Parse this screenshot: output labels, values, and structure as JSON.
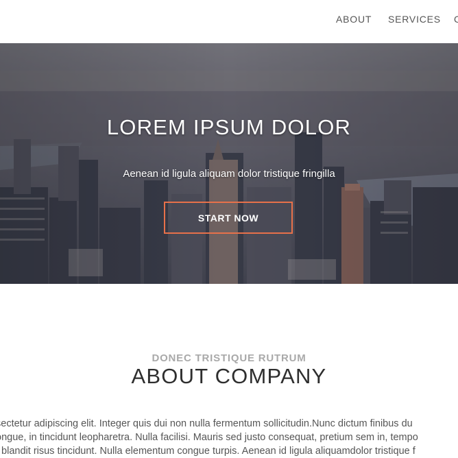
{
  "nav": {
    "items": [
      {
        "label": "ABOUT"
      },
      {
        "label": "SERVICES"
      },
      {
        "label": "C"
      }
    ]
  },
  "hero": {
    "title": "LOREM IPSUM DOLOR",
    "subtitle": "Aenean id ligula aliquam dolor tristique fringilla",
    "button_label": "START NOW",
    "button_border_color": "#e8714a"
  },
  "about": {
    "kicker": "DONEC TRISTIQUE RUTRUM",
    "title": "ABOUT COMPANY",
    "lines": [
      "sectetur adipiscing elit. Integer quis dui non nulla fermentum sollicitudin.Nunc dictum finibus du",
      "ongue, in tincidunt leopharetra. Nulla facilisi. Mauris sed justo consequat, pretium sem in, tempo",
      "t blandit risus tincidunt. Nulla elementum congue turpis. Aenean id ligula aliquamdolor tristique f"
    ]
  }
}
